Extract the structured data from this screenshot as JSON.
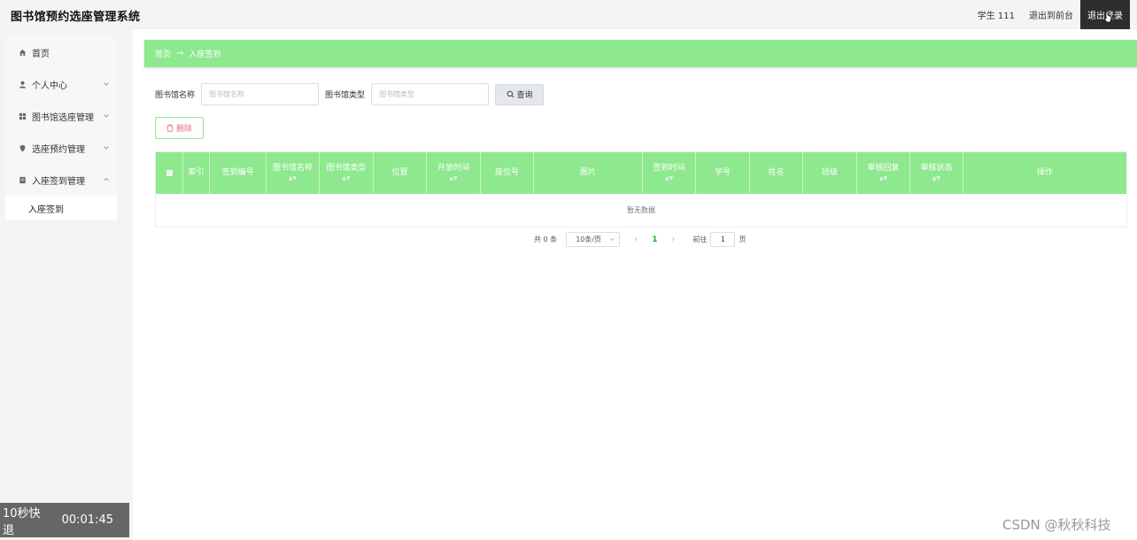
{
  "header": {
    "title": "图书馆预约选座管理系统",
    "user": "学生 111",
    "back_front": "退出到前台",
    "logout": "退出登录"
  },
  "sidebar": {
    "items": [
      {
        "label": "首页",
        "icon": "home-icon"
      },
      {
        "label": "个人中心",
        "icon": "user-icon"
      },
      {
        "label": "图书馆选座管理",
        "icon": "grid-icon"
      },
      {
        "label": "选座预约管理",
        "icon": "location-icon"
      },
      {
        "label": "入座签到管理",
        "icon": "document-icon"
      }
    ],
    "sub_item": "入座签到"
  },
  "timer": {
    "label": "10秒快退",
    "time": "00:01:45"
  },
  "breadcrumb": {
    "home": "首页",
    "arrow": "→",
    "current": "入座签到"
  },
  "search": {
    "name_label": "图书馆名称",
    "name_placeholder": "图书馆名称",
    "type_label": "图书馆类型",
    "type_placeholder": "图书馆类型",
    "button": "查询"
  },
  "actions": {
    "delete": "删除"
  },
  "table": {
    "columns": [
      "索引",
      "签到编号",
      "图书馆名称",
      "图书馆类型",
      "位置",
      "开放时间",
      "座位号",
      "图片",
      "签到时间",
      "学号",
      "姓名",
      "班级",
      "审核回复",
      "审核状态",
      "操作"
    ],
    "empty_text": "暂无数据"
  },
  "pagination": {
    "total": "共 0 条",
    "page_size": "10条/页",
    "prev": "‹",
    "current": "1",
    "next": "›",
    "goto_prefix": "前往",
    "goto_value": "1",
    "goto_suffix": "页"
  },
  "watermark": "CSDN @秋秋科技",
  "colors": {
    "accent_green": "#8ee88e",
    "dark": "#2e2e2e"
  }
}
